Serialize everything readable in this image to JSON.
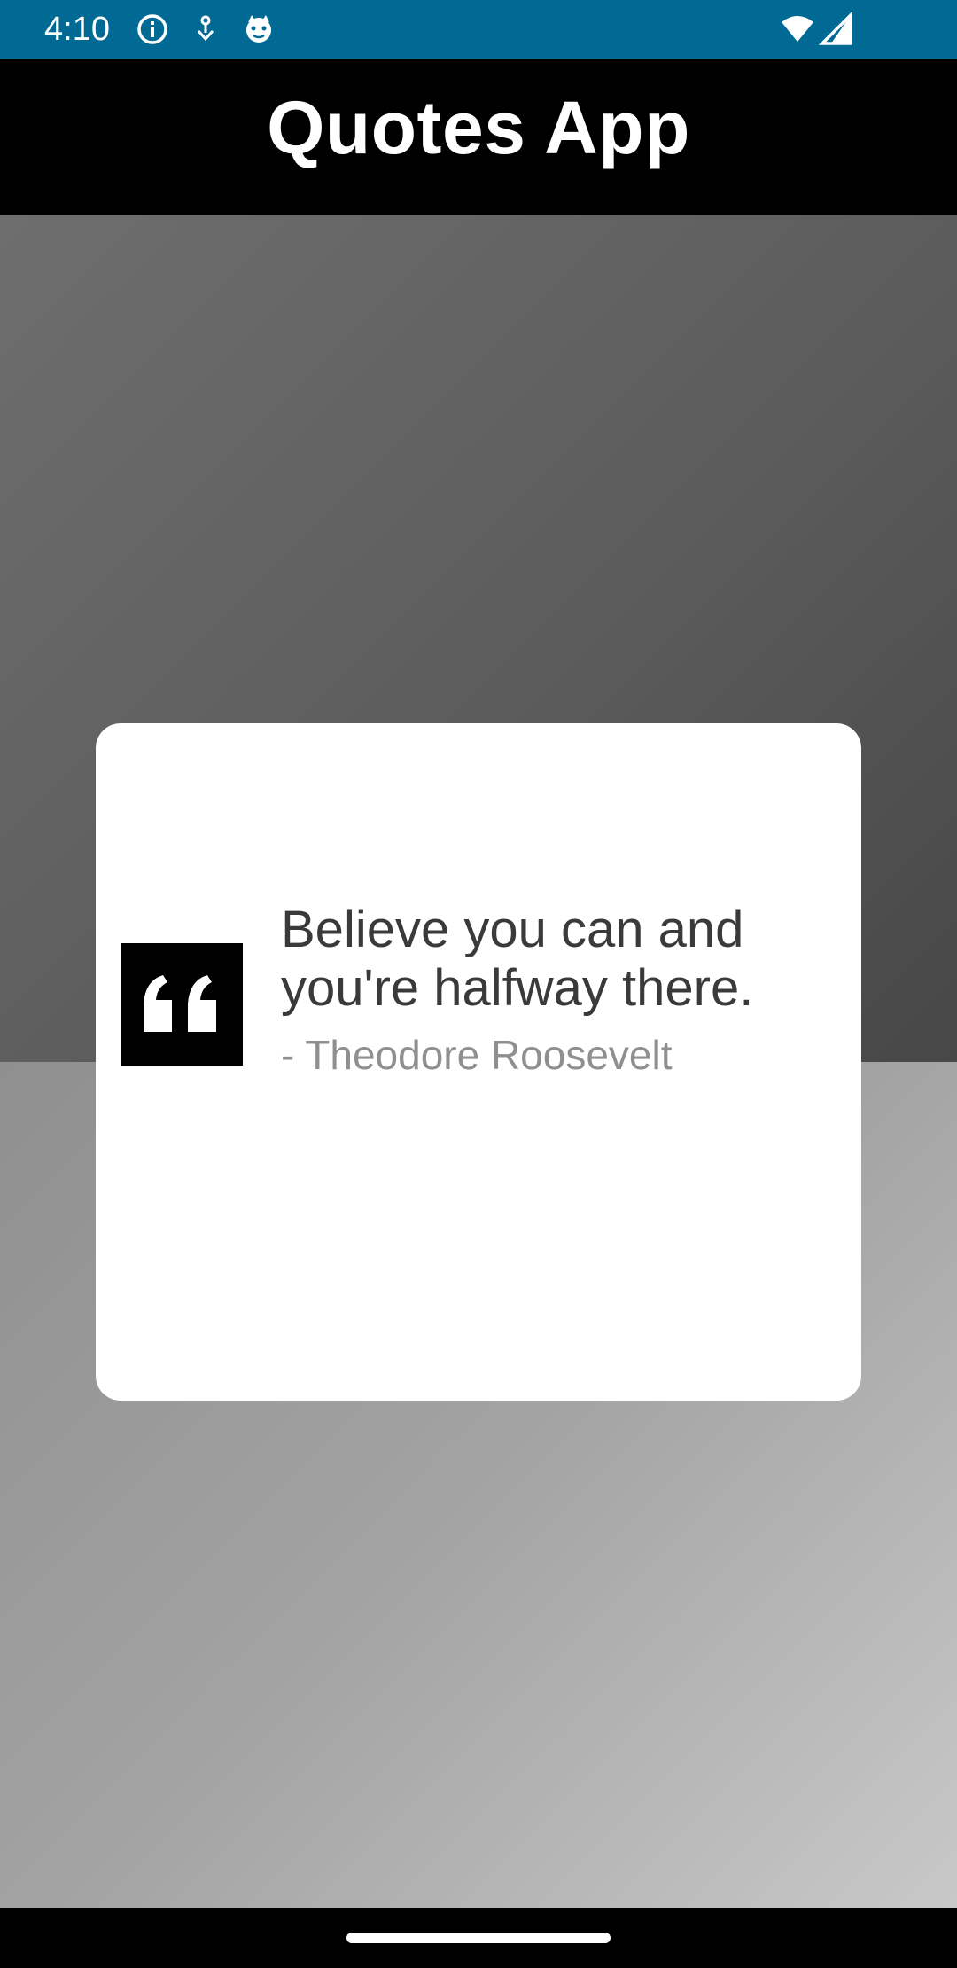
{
  "status_bar": {
    "time": "4:10",
    "icons": [
      "info-icon",
      "download-icon",
      "cat-face-icon",
      "wifi-icon",
      "signal-icon"
    ]
  },
  "app_bar": {
    "title": "Quotes App"
  },
  "quote": {
    "text": "Believe you can and you're halfway there.",
    "author": "- Theodore Roosevelt",
    "icon": "quote-mark-icon"
  },
  "colors": {
    "status_bar_bg": "#006994",
    "app_bar_bg": "#000000",
    "card_bg": "#ffffff",
    "quote_text": "#3a3a3a",
    "author_text": "#8f8f8f"
  }
}
